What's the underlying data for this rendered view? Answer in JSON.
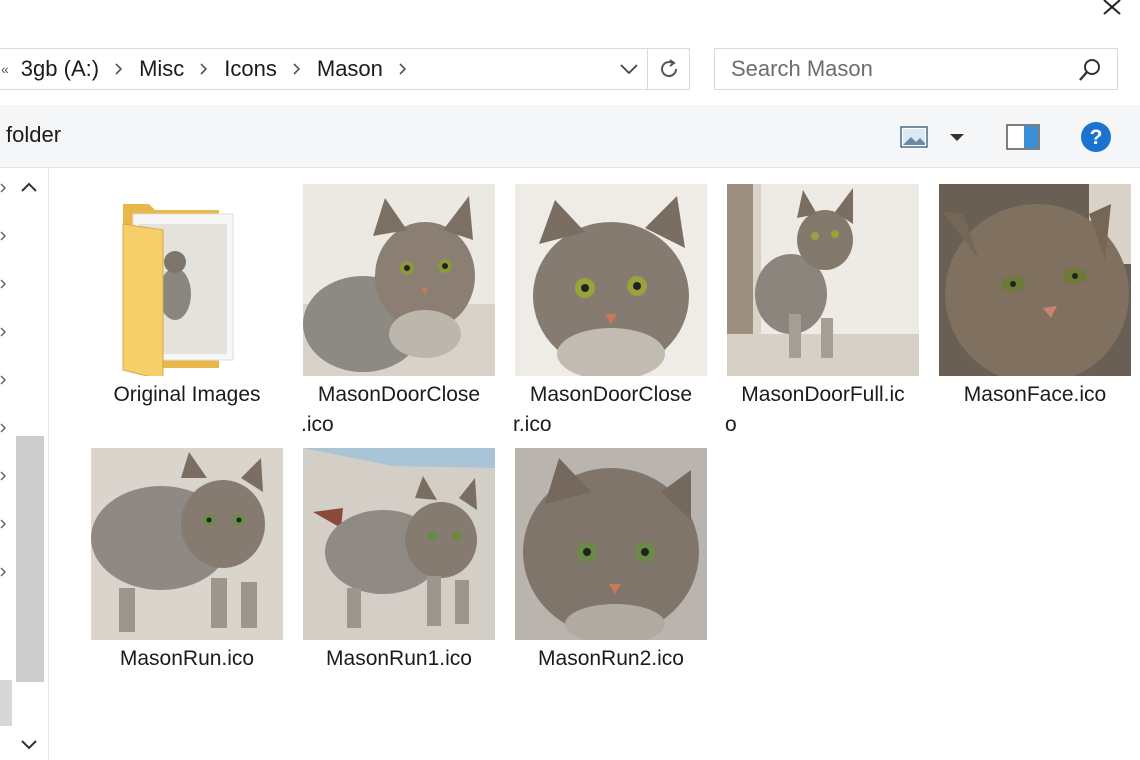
{
  "window": {
    "close_icon": "close-icon"
  },
  "address_bar": {
    "crumbs": [
      "3gb (A:)",
      "Misc",
      "Icons",
      "Mason"
    ],
    "overflow_glyph": "«"
  },
  "search": {
    "placeholder": "Search Mason",
    "value": ""
  },
  "command_bar": {
    "new_folder_partial": "folder"
  },
  "colors": {
    "help_blue": "#1a73d1",
    "folder_yellow": "#f0c75e",
    "scroll_thumb": "#cdcdcd"
  },
  "files": [
    {
      "name": "Original Images",
      "line1": "Original Images",
      "line2": "",
      "type": "folder"
    },
    {
      "name": "MasonDoorClose.ico",
      "line1": "MasonDoorClose",
      "line2": ".ico",
      "type": "image"
    },
    {
      "name": "MasonDoorCloser.ico",
      "line1": "MasonDoorClose",
      "line2": "r.ico",
      "type": "image"
    },
    {
      "name": "MasonDoorFull.ico",
      "line1": "MasonDoorFull.ic",
      "line2": "o",
      "type": "image"
    },
    {
      "name": "MasonFace.ico",
      "line1": "MasonFace.ico",
      "line2": "",
      "type": "image"
    },
    {
      "name": "MasonRun.ico",
      "line1": "MasonRun.ico",
      "line2": "",
      "type": "image"
    },
    {
      "name": "MasonRun1.ico",
      "line1": "MasonRun1.ico",
      "line2": "",
      "type": "image"
    },
    {
      "name": "MasonRun2.ico",
      "line1": "MasonRun2.ico",
      "line2": "",
      "type": "image"
    }
  ]
}
